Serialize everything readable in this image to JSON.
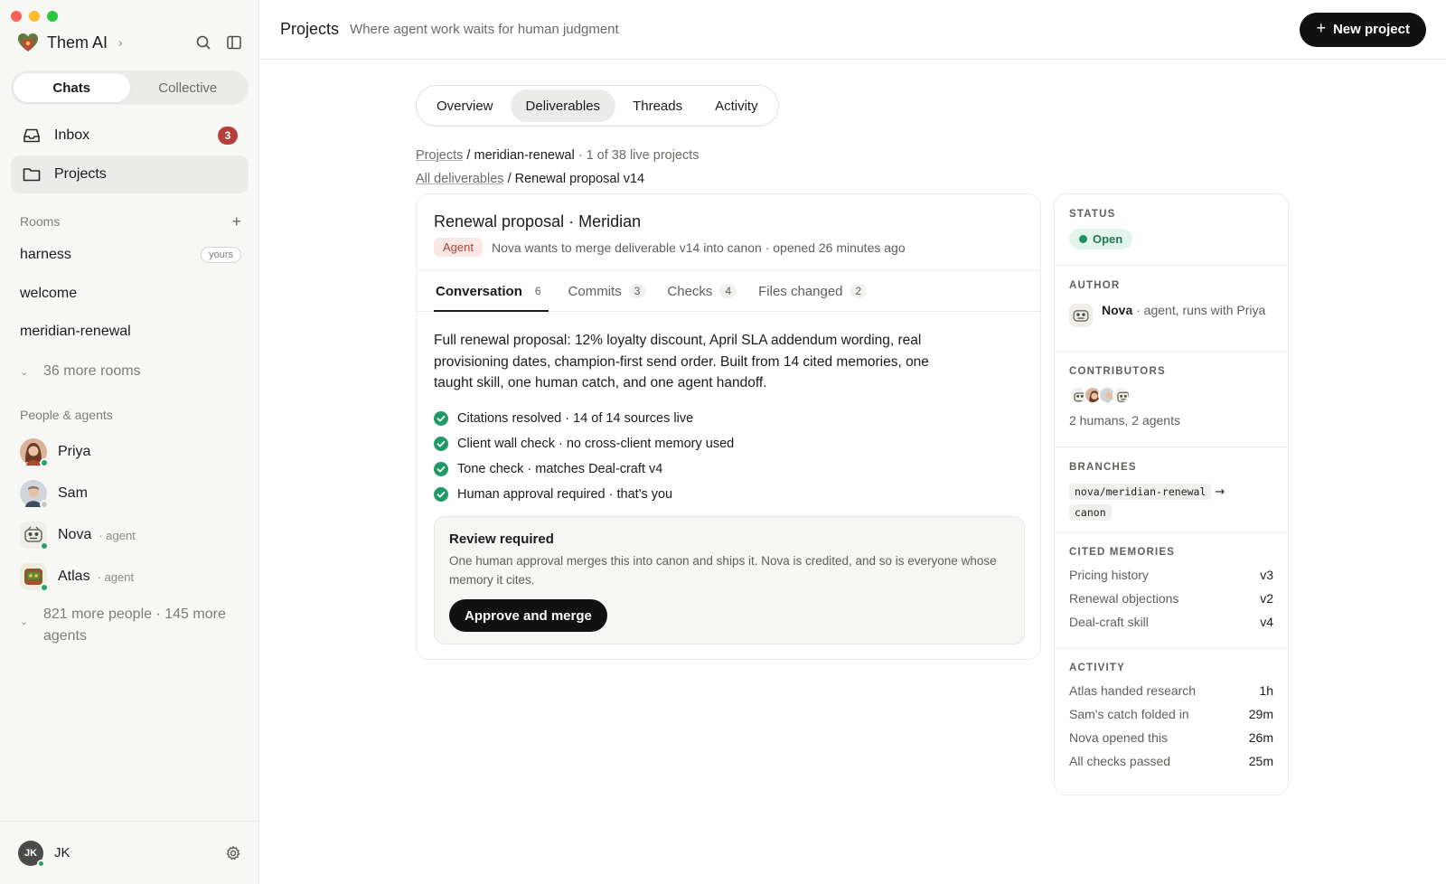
{
  "brand": {
    "name": "Them AI"
  },
  "colors": {
    "accent_badge": "#b3403a",
    "online": "#28a06a",
    "open_status": "#1f7a52",
    "agent_pill": "#fbe7e4"
  },
  "sidebar": {
    "segments": [
      "Chats",
      "Collective"
    ],
    "nav": [
      {
        "label": "Inbox",
        "badge": "3",
        "icon": "inbox-icon"
      },
      {
        "label": "Projects",
        "icon": "folder-icon"
      }
    ],
    "rooms_header": "Rooms",
    "rooms": [
      "harness",
      "welcome",
      "meridian-renewal"
    ],
    "yours_tag": "yours",
    "more_rooms": "36 more rooms",
    "people_header": "People & agents",
    "people": [
      {
        "name": "Priya",
        "role": ""
      },
      {
        "name": "Sam",
        "role": ""
      },
      {
        "name": "Nova",
        "role": "· agent"
      },
      {
        "name": "Atlas",
        "role": "· agent"
      }
    ],
    "more_people": "821 more people · 145 more agents",
    "user": {
      "initials": "JK",
      "name": "JK"
    }
  },
  "header": {
    "title": "Projects",
    "subtitle": "Where agent work waits for human judgment",
    "new_project": "New project"
  },
  "tabs": [
    "Overview",
    "Deliverables",
    "Threads",
    "Activity"
  ],
  "breadcrumb1": {
    "link": "Projects",
    "sep": "/",
    "current": "meridian-renewal",
    "extra": "· 1 of 38 live projects"
  },
  "breadcrumb2": {
    "link": "All deliverables",
    "sep": "/",
    "current": "Renewal proposal v14"
  },
  "deliverable": {
    "title": "Renewal proposal · Meridian",
    "tag": "Agent",
    "meta": "Nova wants to merge deliverable v14 into canon · opened 26 minutes ago",
    "tabs": [
      {
        "label": "Conversation",
        "count": "6"
      },
      {
        "label": "Commits",
        "count": "3"
      },
      {
        "label": "Checks",
        "count": "4"
      },
      {
        "label": "Files changed",
        "count": "2"
      }
    ],
    "body": "Full renewal proposal: 12% loyalty discount, April SLA addendum wording, real provisioning dates, champion-first send order. Built from 14 cited memories, one taught skill, one human catch, and one agent handoff.",
    "checks": [
      "Citations resolved · 14 of 14 sources live",
      "Client wall check · no cross-client memory used",
      "Tone check · matches Deal-craft v4",
      "Human approval required · that's you"
    ],
    "review": {
      "heading": "Review required",
      "text": "One human approval merges this into canon and ships it. Nova is credited, and so is everyone whose memory it cites.",
      "button": "Approve and merge"
    }
  },
  "panel": {
    "status_label": "STATUS",
    "status": "Open",
    "author_label": "AUTHOR",
    "author_name": "Nova",
    "author_desc": "· agent, runs with Priya",
    "contributors_label": "CONTRIBUTORS",
    "contributors_summary": "2 humans, 2 agents",
    "branches_label": "BRANCHES",
    "branch_from": "nova/meridian-renewal",
    "branch_arrow": "→",
    "branch_to": "canon",
    "memories_label": "CITED MEMORIES",
    "memories": [
      {
        "name": "Pricing history",
        "version": "v3"
      },
      {
        "name": "Renewal objections",
        "version": "v2"
      },
      {
        "name": "Deal-craft skill",
        "version": "v4"
      }
    ],
    "activity_label": "ACTIVITY",
    "activity": [
      {
        "text": "Atlas handed research",
        "time": "1h"
      },
      {
        "text": "Sam's catch folded in",
        "time": "29m"
      },
      {
        "text": "Nova opened this",
        "time": "26m"
      },
      {
        "text": "All checks passed",
        "time": "25m"
      }
    ]
  }
}
